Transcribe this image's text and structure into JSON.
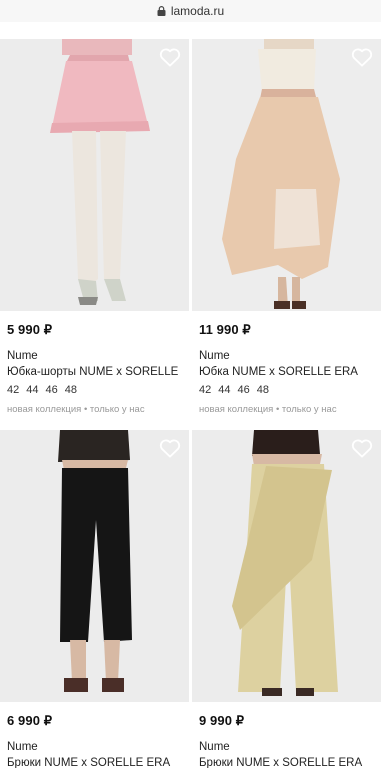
{
  "browser": {
    "url": "lamoda.ru"
  },
  "products": [
    {
      "price": "5 990 ₽",
      "brand": "Nume",
      "name": "Юбка-шорты NUME x SORELLE",
      "sizes": [
        "42",
        "44",
        "46",
        "48"
      ],
      "tags": [
        "новая коллекция",
        "только у нас"
      ],
      "image": "pink-skirt-shorts-photo"
    },
    {
      "price": "11 990 ₽",
      "brand": "Nume",
      "name": "Юбка NUME x SORELLE ERA",
      "sizes": [
        "42",
        "44",
        "46",
        "48"
      ],
      "tags": [
        "новая коллекция",
        "только у нас"
      ],
      "image": "beige-draped-skirt-photo"
    },
    {
      "price": "6 990 ₽",
      "brand": "Nume",
      "name": "Брюки NUME x SORELLE ERA",
      "image": "black-trousers-photo"
    },
    {
      "price": "9 990 ₽",
      "brand": "Nume",
      "name": "Брюки NUME x SORELLE ERA",
      "image": "yellow-wide-trousers-photo"
    }
  ],
  "tag_separator": "•",
  "icons": {
    "favorite": "heart-outline-icon",
    "lock": "lock-icon"
  }
}
